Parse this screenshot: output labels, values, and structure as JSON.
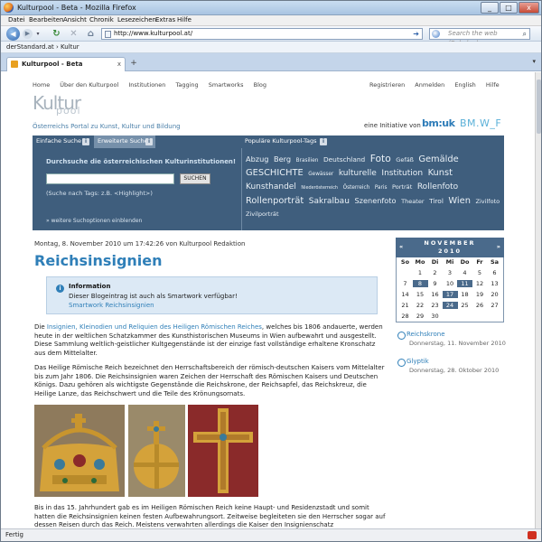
{
  "window": {
    "title": "Kulturpool - Beta - Mozilla Firefox",
    "min": "_",
    "max": "□",
    "close": "x"
  },
  "menu": [
    "Datei",
    "Bearbeiten",
    "Ansicht",
    "Chronik",
    "Lesezeichen",
    "Extras",
    "Hilfe"
  ],
  "nav": {
    "url": "http://www.kulturpool.at/",
    "search_placeholder": "Search the web (Babylon)"
  },
  "bookmarks": {
    "item": "derStandard.at › Kultur"
  },
  "tab": {
    "label": "Kulturpool - Beta",
    "close": "x",
    "new": "+"
  },
  "status": {
    "text": "Fertig"
  },
  "site": {
    "nav_left": [
      "Home",
      "Über den Kulturpool",
      "Institutionen",
      "Tagging",
      "Smartworks",
      "Blog"
    ],
    "nav_right": [
      "Registrieren",
      "Anmelden",
      "English",
      "Hilfe"
    ],
    "logo_top": "Kultur",
    "logo_bottom": "pool",
    "tagline": "Österreichs Portal zu Kunst, Kultur und Bildung",
    "initiative": "eine Initiative von",
    "partner1": "bm:uk",
    "partner2": "BM.W_F",
    "search_tabs": [
      "Einfache Suche",
      "Erweiterte Suche"
    ],
    "search_heading": "Durchsuche die österreichischen Kulturinstitutionen!",
    "search_button": "SUCHEN",
    "search_hint": "(Suche nach Tags: z.B. <Highlight>)",
    "search_more": "» weitere Suchoptionen einblenden",
    "tags_title": "Populäre Kulturpool-Tags",
    "tags": [
      {
        "t": "Abzug",
        "s": 10
      },
      {
        "t": "Berg",
        "s": 10
      },
      {
        "t": "Brasilien",
        "s": 7
      },
      {
        "t": "Deutschland",
        "s": 9
      },
      {
        "t": "Foto",
        "s": 13
      },
      {
        "t": "Gefäß",
        "s": 8
      },
      {
        "t": "Gemälde",
        "s": 12
      },
      {
        "t": "GESCHICHTE",
        "s": 12
      },
      {
        "t": "Gewässer",
        "s": 7
      },
      {
        "t": "kulturelle",
        "s": 11
      },
      {
        "t": "Institution",
        "s": 11
      },
      {
        "t": "Kunst",
        "s": 12
      },
      {
        "t": "Kunsthandel",
        "s": 11
      },
      {
        "t": "Niederösterreich",
        "s": 6
      },
      {
        "t": "Österreich",
        "s": 7
      },
      {
        "t": "Paris",
        "s": 7
      },
      {
        "t": "Porträt",
        "s": 8
      },
      {
        "t": "Rollenfoto",
        "s": 11
      },
      {
        "t": "Rollenporträt",
        "s": 12
      },
      {
        "t": "Sakralbau",
        "s": 11
      },
      {
        "t": "Szenenfoto",
        "s": 10
      },
      {
        "t": "Theater",
        "s": 8
      },
      {
        "t": "Tirol",
        "s": 9
      },
      {
        "t": "Wien",
        "s": 12
      },
      {
        "t": "Zivilfoto",
        "s": 8
      },
      {
        "t": "Zivilporträt",
        "s": 8
      }
    ]
  },
  "post": {
    "meta": "Montag, 8. November 2010 um 17:42:26 von Kulturpool Redaktion",
    "title": "Reichsinsignien",
    "info_title": "Information",
    "info_text": "Dieser Blogeintrag ist auch als Smartwork verfügbar!",
    "info_link": "Smartwork Reichsinsignien",
    "p1_pre": "Die ",
    "p1_link": "Insignien, Kleinodien und Reliquien des Heiligen Römischen Reiches",
    "p1_post": ", welches bis 1806 andauerte, werden heute in der weltlichen Schatzkammer des Kunsthistorischen Museums in Wien aufbewahrt und ausgestellt. Diese Sammlung weltlich-geistlicher Kultgegenstände ist der einzige fast vollständige erhaltene Kronschatz aus dem Mittelalter.",
    "p2": "Das Heilige Römische Reich bezeichnet den Herrschaftsbereich der römisch-deutschen Kaisers vom Mittelalter bis zum Jahr 1806. Die Reichsinsignien waren Zeichen der Herrschaft des Römischen Kaisers und Deutschen Königs. Dazu gehören als wichtigste Gegenstände die Reichskrone, der Reichsapfel, das Reichskreuz, die Heilige Lanze, das Reichschwert und die Teile des Krönungsornats.",
    "p3": "Bis in das 15. Jahrhundert gab es im Heiligen Römischen Reich keine Haupt- und Residenzstadt und somit hatten die Reichsinsignien keinen festen Aufbewahrungsort. Zeitweise begleiteten sie den Herrscher sogar auf dessen Reisen durch das Reich. Meistens verwahrten allerdings die Kaiser den Insignienschatz"
  },
  "calendar": {
    "month": "NOVEMBER",
    "year": "2010",
    "prev": "«",
    "next": "»",
    "days": [
      "So",
      "Mo",
      "Di",
      "Mi",
      "Do",
      "Fr",
      "Sa"
    ],
    "rows": [
      [
        "",
        "1",
        "2",
        "3",
        "4",
        "5",
        "6"
      ],
      [
        "7",
        "8",
        "9",
        "10",
        "11",
        "12",
        "13"
      ],
      [
        "14",
        "15",
        "16",
        "17",
        "18",
        "19",
        "20"
      ],
      [
        "21",
        "22",
        "23",
        "24",
        "25",
        "26",
        "27"
      ],
      [
        "28",
        "29",
        "30",
        "",
        "",
        "",
        ""
      ]
    ],
    "highlighted": [
      "8",
      "11",
      "17",
      "24"
    ]
  },
  "sidebar": [
    {
      "title": "Reichskrone",
      "date": "Donnerstag, 11. November 2010"
    },
    {
      "title": "Glyptik",
      "date": "Donnerstag, 28. Oktober 2010"
    }
  ]
}
